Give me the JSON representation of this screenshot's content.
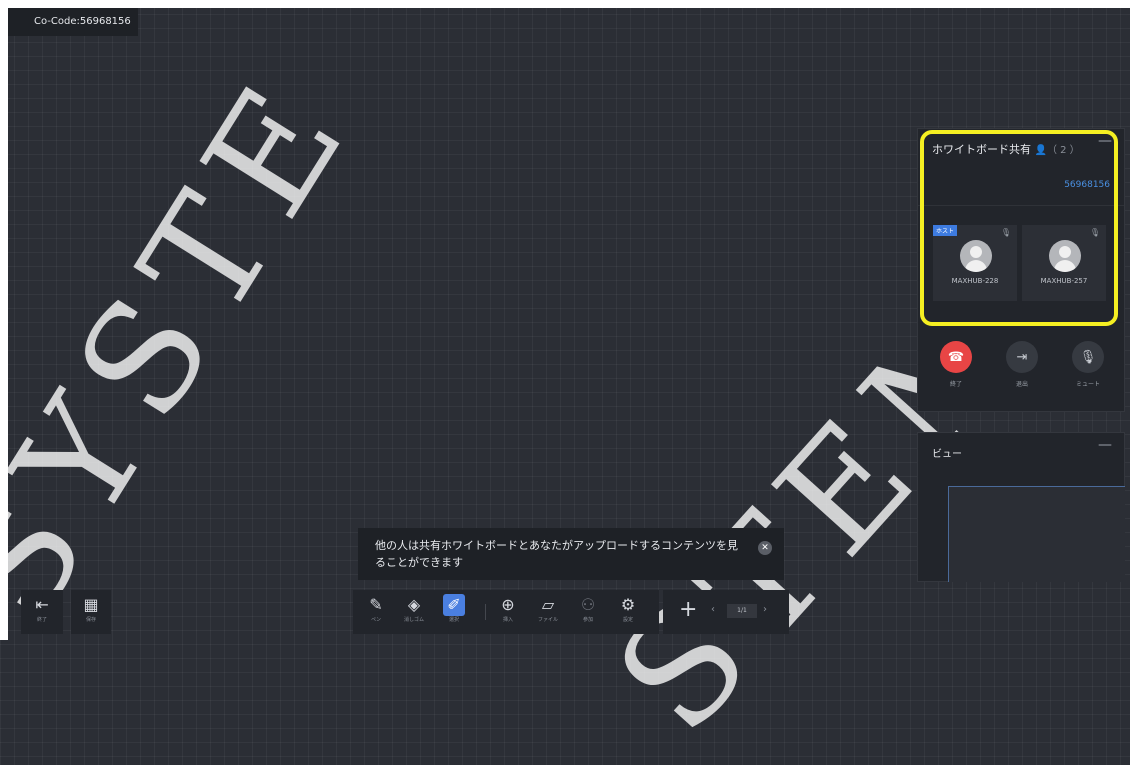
{
  "co_code": "Co-Code:56968156",
  "watermark": [
    "SYSTE",
    "STEM"
  ],
  "share_panel": {
    "title": "ホワイトボード共有",
    "participants": "（ 2 ）",
    "code": "56968156",
    "tiles": [
      {
        "badge": "ホスト",
        "name": "MAXHUB-228"
      },
      {
        "name": "MAXHUB-257"
      }
    ],
    "controls": {
      "end": "終了",
      "leave": "退出",
      "mute": "ミュート"
    }
  },
  "view_panel": {
    "title": "ビュー"
  },
  "toast": {
    "text": "他の人は共有ホワイトボードとあなたがアップロードするコンテンツを見ることができます"
  },
  "toolbar": {
    "exit": "終了",
    "save": "保存",
    "pen": "ペン",
    "eraser": "消しゴム",
    "select": "選択",
    "insert": "挿入",
    "file": "ファイル",
    "invite": "参加",
    "settings": "設定"
  },
  "pager": {
    "page": "1/1"
  },
  "colors": {
    "accent": "#4a7fe0",
    "end_call": "#e84545",
    "highlight": "#f5ef22"
  }
}
